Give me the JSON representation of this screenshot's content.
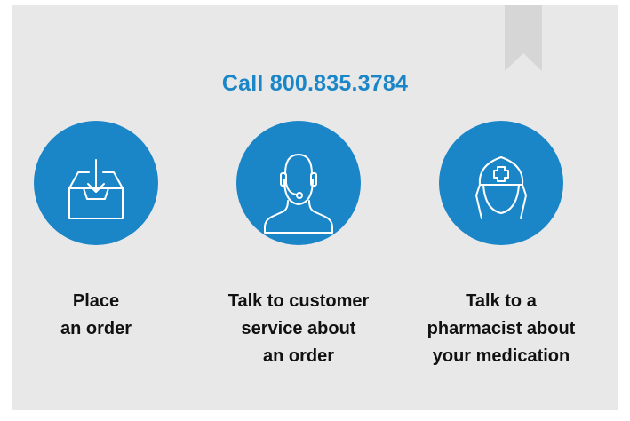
{
  "header": {
    "phone_text": "Call 800.835.3784"
  },
  "options": [
    {
      "icon": "inbox-download-icon",
      "lines": [
        "Place",
        "an order"
      ]
    },
    {
      "icon": "headset-agent-icon",
      "lines": [
        "Talk to customer",
        "service about",
        "an order"
      ]
    },
    {
      "icon": "pharmacist-nurse-icon",
      "lines": [
        "Talk to a",
        "pharmacist about",
        "your medication"
      ]
    }
  ],
  "colors": {
    "accent": "#1a86c8",
    "card_bg": "#e8e8e8",
    "ribbon": "#d6d6d6",
    "text": "#111111"
  }
}
